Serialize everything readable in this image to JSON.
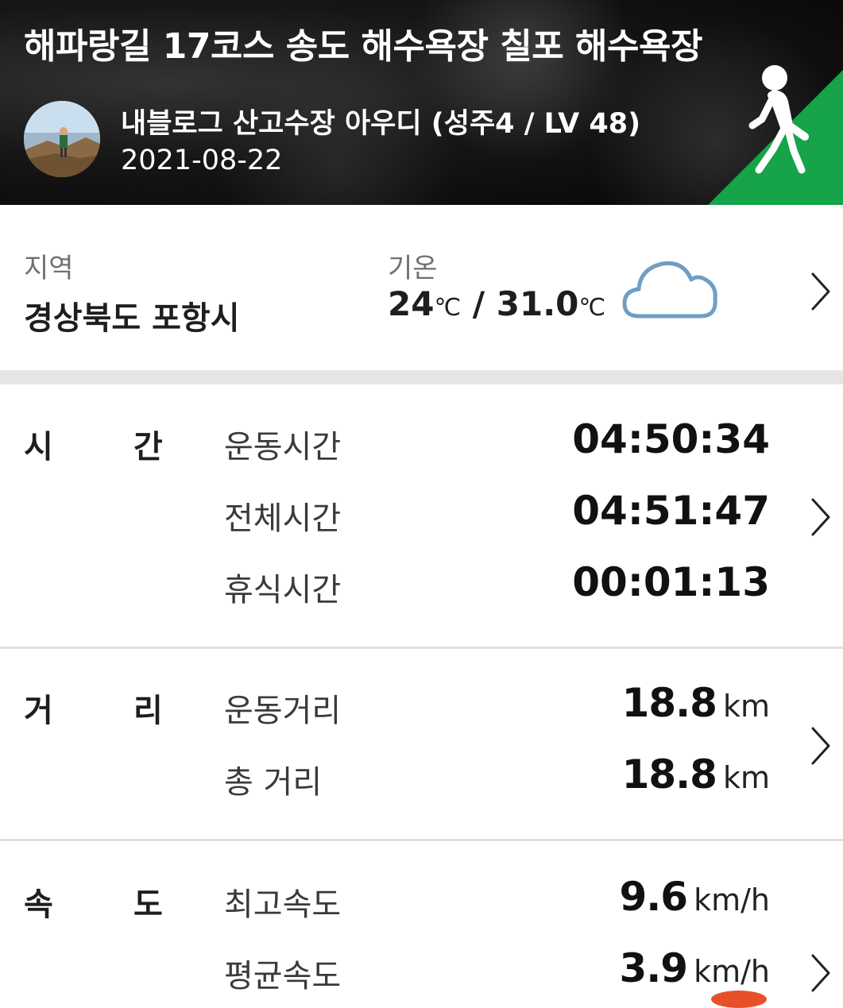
{
  "header": {
    "title": "해파랑길 17코스 송도 해수욕장 칠포 해수욕장",
    "author": "내블로그 산고수장 아우디 (성주4 / LV 48)",
    "date": "2021-08-22",
    "activity_icon": "walking-person-icon",
    "accent_color": "#16a34a"
  },
  "region": {
    "label": "지역",
    "value": "경상북도 포항시"
  },
  "weather": {
    "label": "기온",
    "low": "24",
    "low_unit": "℃",
    "separator": "/",
    "high": "31.0",
    "high_unit": "℃",
    "icon": "cloud-icon"
  },
  "time": {
    "category_chars": [
      "시",
      "간"
    ],
    "rows": [
      {
        "label": "운동시간",
        "value": "04:50:34"
      },
      {
        "label": "전체시간",
        "value": "04:51:47"
      },
      {
        "label": "휴식시간",
        "value": "00:01:13"
      }
    ]
  },
  "distance": {
    "category_chars": [
      "거",
      "리"
    ],
    "rows": [
      {
        "label": "운동거리",
        "value": "18.8",
        "unit": "km"
      },
      {
        "label": "총 거리",
        "value": "18.8",
        "unit": "km"
      }
    ]
  },
  "speed": {
    "category_chars": [
      "속",
      "도"
    ],
    "rows": [
      {
        "label": "최고속도",
        "value": "9.6",
        "unit": "km/h"
      },
      {
        "label": "평균속도",
        "value": "3.9",
        "unit": "km/h"
      }
    ]
  }
}
